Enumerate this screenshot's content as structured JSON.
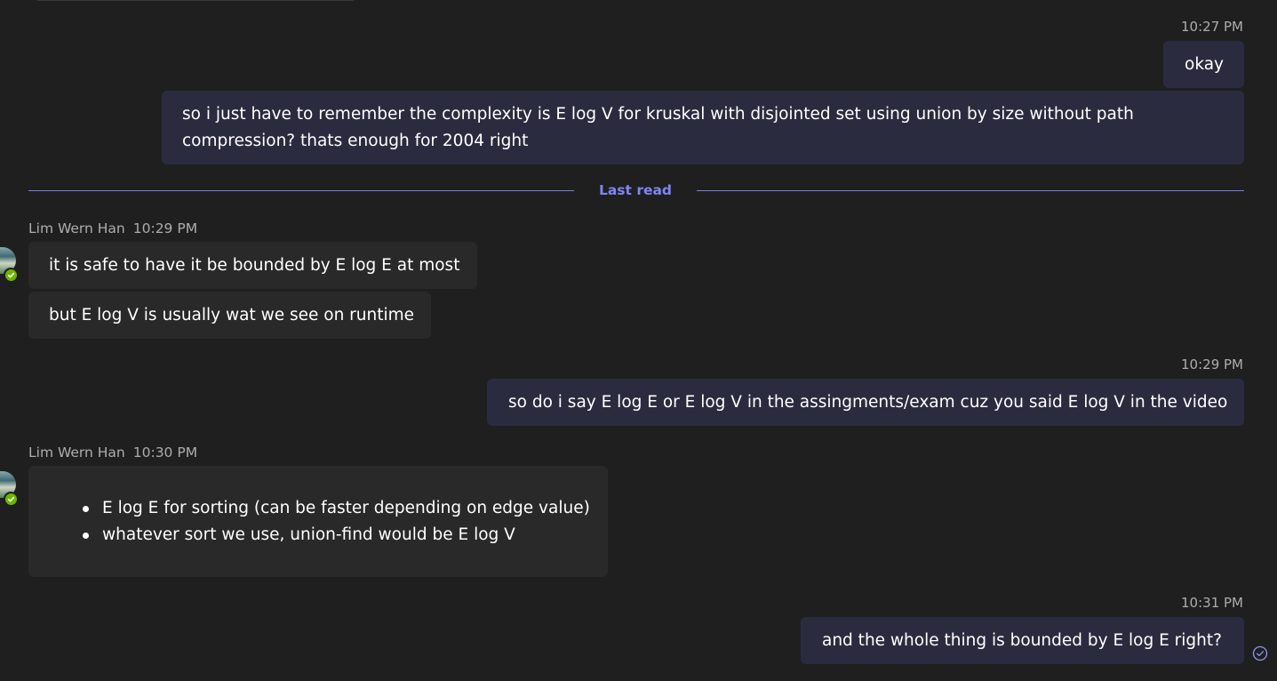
{
  "messages": [
    {
      "id": "m1",
      "ts": "10:27 PM",
      "text": "okay"
    },
    {
      "id": "m2",
      "line1": "so i just have to remember the complexity is E log V for kruskal with disjointed set using union by size without path",
      "line2": "compression? thats enough for 2004 right"
    },
    {
      "id": "m3",
      "sender": "Lim Wern Han",
      "ts": "10:29 PM",
      "text": "it is safe to have it be bounded by E log E at most"
    },
    {
      "id": "m4",
      "text": "but E log V is usually wat we see on runtime"
    },
    {
      "id": "m5",
      "ts": "10:29 PM",
      "text": "so do i say E log E or E log V in the assingments/exam cuz you said E log V in the video"
    },
    {
      "id": "m6",
      "sender": "Lim Wern Han",
      "ts": "10:30 PM",
      "bullets": [
        "E log E for sorting (can be faster depending on edge value)",
        "whatever sort we use, union-find would be E log V"
      ]
    },
    {
      "id": "m7",
      "ts": "10:31 PM",
      "text": "and the whole thing is bounded by E log E right?"
    }
  ],
  "divider": {
    "label": "Last read"
  },
  "status": {
    "read_icon": "check-circle-icon",
    "presence_icon": "available-check-icon"
  },
  "colors": {
    "background": "#1f1f1f",
    "outgoing_bubble": "#2b2b40",
    "incoming_bubble": "#292929",
    "accent": "#7f85f5",
    "presence": "#6bb700"
  }
}
